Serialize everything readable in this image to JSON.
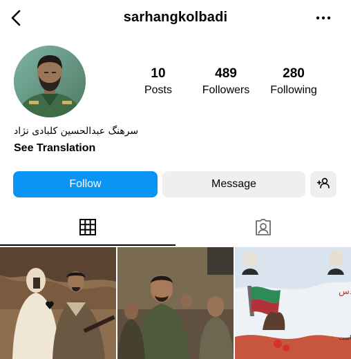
{
  "header": {
    "username": "sarhangkolbadi"
  },
  "profile": {
    "stats": [
      {
        "value": "10",
        "label": "Posts"
      },
      {
        "value": "489",
        "label": "Followers"
      },
      {
        "value": "280",
        "label": "Following"
      }
    ],
    "bio_name": "سرهنگ عبدالحسین کلبادی نژاد",
    "see_translation": "See Translation"
  },
  "actions": {
    "follow_label": "Follow",
    "message_label": "Message",
    "add_icon": "add-person-icon",
    "follow_color": "#0A95F6",
    "secondary_bg": "#EFEFEF"
  },
  "tabs": [
    {
      "icon": "grid-icon",
      "active": true
    },
    {
      "icon": "tagged-icon",
      "active": false
    }
  ],
  "posts": [
    {
      "thumb_text": ""
    },
    {
      "thumb_text": ""
    },
    {
      "thumb_text": "هفته دفاع مقدس",
      "thumb_subtext": "نشستن شرط شهادت است"
    }
  ]
}
